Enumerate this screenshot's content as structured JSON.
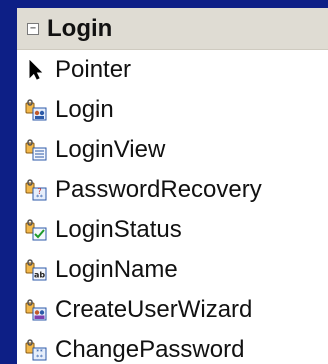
{
  "toolbox": {
    "group": {
      "toggle_symbol": "−",
      "title": "Login"
    },
    "items": [
      {
        "label": "Pointer",
        "icon": "pointer-icon"
      },
      {
        "label": "Login",
        "icon": "login-control-icon"
      },
      {
        "label": "LoginView",
        "icon": "loginview-control-icon"
      },
      {
        "label": "PasswordRecovery",
        "icon": "passwordrecovery-control-icon"
      },
      {
        "label": "LoginStatus",
        "icon": "loginstatus-control-icon"
      },
      {
        "label": "LoginName",
        "icon": "loginname-control-icon"
      },
      {
        "label": "CreateUserWizard",
        "icon": "createuserwizard-control-icon"
      },
      {
        "label": "ChangePassword",
        "icon": "changepassword-control-icon"
      }
    ]
  },
  "colors": {
    "background": "#0d1f86",
    "header": "#dfdcd3",
    "panel": "#ffffff"
  }
}
